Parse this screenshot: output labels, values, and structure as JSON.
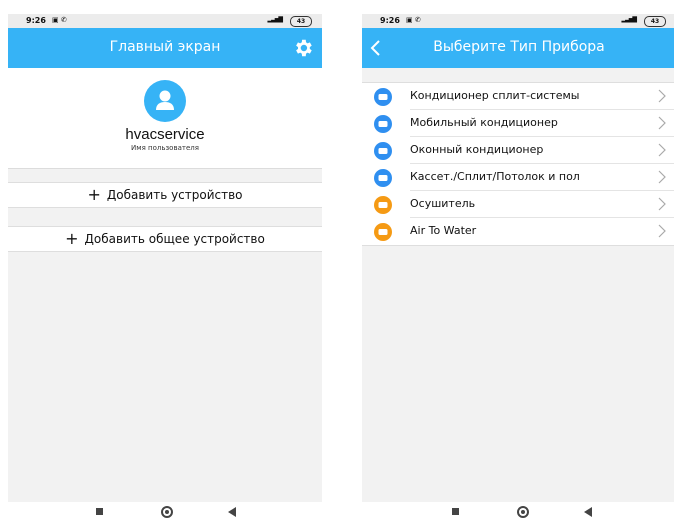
{
  "status": {
    "time": "9:26",
    "signal": "4G+",
    "battery": "43"
  },
  "screen1": {
    "title": "Главный экран",
    "username": "hvacservice",
    "username_label": "Имя пользователя",
    "add_device": "Добавить устройство",
    "add_shared_device": "Добавить общее устройство"
  },
  "screen2": {
    "title": "Выберите Тип Прибора",
    "items": [
      {
        "label": "Кондиционер сплит-системы",
        "icon": "split-ac-icon",
        "color": "#2f8ff0"
      },
      {
        "label": "Мобильный кондиционер",
        "icon": "mobile-ac-icon",
        "color": "#2f8ff0"
      },
      {
        "label": "Оконный кондиционер",
        "icon": "window-ac-icon",
        "color": "#2f8ff0"
      },
      {
        "label": "Кассет./Сплит/Потолок и пол",
        "icon": "cassette-ac-icon",
        "color": "#2f8ff0"
      },
      {
        "label": "Осушитель",
        "icon": "dehumidifier-icon",
        "color": "#f59a14"
      },
      {
        "label": "Air To Water",
        "icon": "air-to-water-icon",
        "color": "#f59a14"
      }
    ]
  },
  "colors": {
    "accent": "#36b3f6",
    "orange": "#f59a14",
    "blue": "#2f8ff0"
  }
}
